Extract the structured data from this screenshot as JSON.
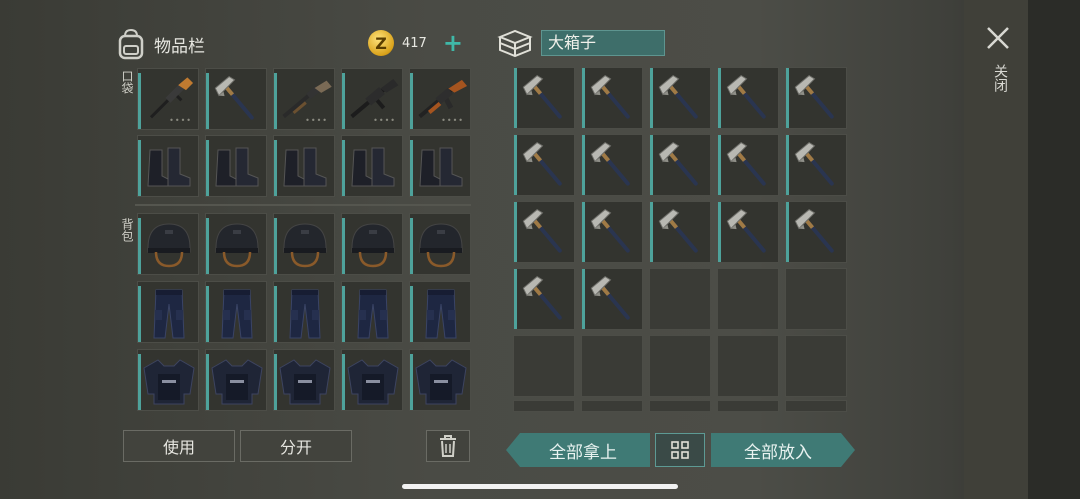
{
  "inventory": {
    "title": "物品栏",
    "pocket_label": "口袋",
    "backpack_label": "背包",
    "coins": "417",
    "coin_symbol": "Z",
    "pocket_row1": [
      "rifle-icon",
      "hatchet-icon",
      "shotgun-icon",
      "assault-rifle-icon",
      "ak-rifle-icon"
    ],
    "pocket_row2": [
      "boots-icon",
      "boots-icon",
      "boots-icon",
      "boots-icon",
      "boots-icon"
    ],
    "backpack_rows": [
      [
        "helmet-icon",
        "helmet-icon",
        "helmet-icon",
        "helmet-icon",
        "helmet-icon"
      ],
      [
        "pants-icon",
        "pants-icon",
        "pants-icon",
        "pants-icon",
        "pants-icon"
      ],
      [
        "vest-icon",
        "vest-icon",
        "vest-icon",
        "vest-icon",
        "vest-icon"
      ]
    ]
  },
  "box": {
    "name": "大箱子",
    "items_count": 17,
    "item_icon": "hatchet-icon"
  },
  "close_label": "关闭",
  "buttons": {
    "use": "使用",
    "split": "分开",
    "take_all": "全部拿上",
    "put_all": "全部放入"
  },
  "colors": {
    "accent": "#3f7a75",
    "slot_bar": "#4ea29b",
    "coin": "#d9a21b"
  }
}
